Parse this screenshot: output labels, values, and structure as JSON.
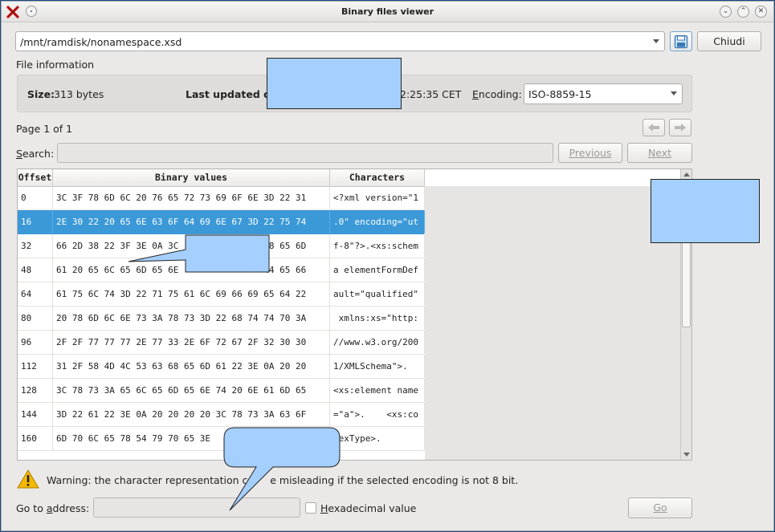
{
  "window": {
    "title": "Binary files viewer"
  },
  "path_combo": {
    "value": "/mnt/ramdisk/nonamespace.xsd"
  },
  "buttons": {
    "close": "Chiudi",
    "previous": "Previous",
    "next": "Next",
    "go": "Go"
  },
  "file_info": {
    "section_label": "File information",
    "size_label": "Size:",
    "size_value": "313 bytes",
    "updated_label": "Last updated on:",
    "updated_value": "2:25:35 CET",
    "encoding_label": "Encoding:",
    "encoding_value": "ISO-8859-15"
  },
  "pager": {
    "text": "Page 1 of 1"
  },
  "search": {
    "label": "Search:",
    "value": ""
  },
  "table": {
    "headers": {
      "offset": "Offset",
      "binary": "Binary values",
      "chars": "Characters"
    },
    "rows": [
      {
        "offset": "0",
        "hex": "3C 3F 78 6D 6C 20 76 65 72 73 69 6F 6E 3D 22 31",
        "chars": "<?xml version=\"1"
      },
      {
        "offset": "16",
        "hex": "2E 30 22 20 65 6E 63 6F 64 69 6E 67 3D 22 75 74",
        "chars": ".0\" encoding=\"ut"
      },
      {
        "offset": "32",
        "hex": "66 2D 38 22 3F 3E 0A 3C                68 65 6D",
        "chars": "f-8\"?>.<xs:schem"
      },
      {
        "offset": "48",
        "hex": "61 20 65 6C 65 6D 65 6E                44 65 66",
        "chars": "a elementFormDef"
      },
      {
        "offset": "64",
        "hex": "61 75 6C 74 3D 22 71 75 61 6C 69 66 69 65 64 22",
        "chars": "ault=\"qualified\""
      },
      {
        "offset": "80",
        "hex": "20 78 6D 6C 6E 73 3A 78 73 3D 22 68 74 74 70 3A",
        "chars": " xmlns:xs=\"http:"
      },
      {
        "offset": "96",
        "hex": "2F 2F 77 77 77 2E 77 33 2E 6F 72 67 2F 32 30 30",
        "chars": "//www.w3.org/200"
      },
      {
        "offset": "112",
        "hex": "31 2F 58 4D 4C 53 63 68 65 6D 61 22 3E 0A 20 20",
        "chars": "1/XMLSchema\">."
      },
      {
        "offset": "128",
        "hex": "3C 78 73 3A 65 6C 65 6D 65 6E 74 20 6E 61 6D 65",
        "chars": "<xs:element name"
      },
      {
        "offset": "144",
        "hex": "3D 22 61 22 3E 0A 20 20 20 20 3C 78 73 3A 63 6F",
        "chars": "=\"a\">.    <xs:co"
      },
      {
        "offset": "160",
        "hex": "6D 70 6C 65 78 54 79 70 65 3E",
        "chars": "lexType>."
      }
    ]
  },
  "warning": {
    "text": "Warning: the character representation c       e misleading if the selected encoding is not 8 bit."
  },
  "goto": {
    "label": "Go to address:",
    "value": "",
    "hex_label": "Hexadecimal value"
  },
  "colors": {
    "selection": "#3b99d8",
    "redaction": "#a4cfff",
    "window_bg": "#eae9e7"
  }
}
